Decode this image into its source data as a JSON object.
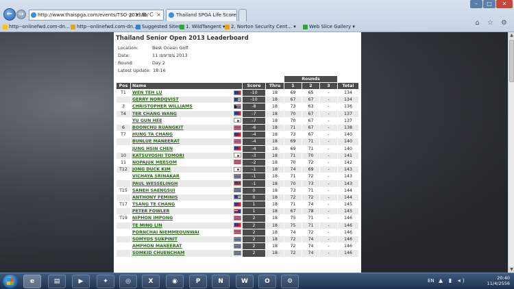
{
  "browser": {
    "address_url": "http://www.thaispga.com/events/TSO-2013/lb/",
    "address_tools": "ρ ▾ ⊠ C ×",
    "tab_title": "Thailand SPGA Life Scorebo...",
    "tab_close": "×",
    "new_tab": "",
    "back_glyph": "←",
    "forward_glyph": "→",
    "win_min": "–",
    "win_max": "□",
    "win_close": "✕",
    "right_icons": "⌂ ☆ ⚙",
    "favorites": [
      {
        "label": "http--onlinefwd.com-dn..."
      },
      {
        "label": "http--onlinefwd.com-dn..."
      },
      {
        "label": "Suggested Sites ▾"
      },
      {
        "label": "1. WildTangent ▾"
      },
      {
        "label": "2. Norton Security Cent... ▾"
      },
      {
        "label": "Web Slice Gallery ▾"
      }
    ]
  },
  "leaderboard": {
    "title": "Thailand Senior Open 2013 Leaderboard",
    "location_label": "Location:",
    "location": "Best Ocean Golf",
    "date_label": "Date:",
    "date": "11 เมษายน 2013",
    "round_label": "Round:",
    "round": "Day 2",
    "update_label": "Latest Update:",
    "update": "18:16",
    "headers": {
      "rounds": "Rounds",
      "pos": "Pos",
      "name": "Name",
      "score": "Score",
      "thru": "Thru",
      "r1": "1",
      "r2": "2",
      "r3": "3",
      "total": "Total"
    },
    "rows": [
      {
        "pos": "T1",
        "name": "WEN TEH LU",
        "flag": "tw",
        "score": "-10",
        "thru": "18",
        "r1": "69",
        "r2": "65",
        "r3": "-",
        "total": "134"
      },
      {
        "pos": "",
        "name": "GERRY NORDQVIST",
        "flag": "us",
        "score": "-10",
        "thru": "18",
        "r1": "67",
        "r2": "67",
        "r3": "-",
        "total": "134"
      },
      {
        "pos": "3",
        "name": "CHRISTOPHER WILLIAMS",
        "flag": "za",
        "score": "-8",
        "thru": "18",
        "r1": "73",
        "r2": "63",
        "r3": "-",
        "total": "136"
      },
      {
        "pos": "T4",
        "name": "TER CHANG WANG",
        "flag": "tw",
        "score": "-7",
        "thru": "18",
        "r1": "70",
        "r2": "67",
        "r3": "-",
        "total": "137"
      },
      {
        "pos": "",
        "name": "YU GUN HEE",
        "flag": "kr",
        "score": "-7",
        "thru": "18",
        "r1": "70",
        "r2": "67",
        "r3": "-",
        "total": "137"
      },
      {
        "pos": "6",
        "name": "BOONCHU RUANGKIT",
        "flag": "th",
        "score": "-6",
        "thru": "18",
        "r1": "71",
        "r2": "67",
        "r3": "-",
        "total": "138"
      },
      {
        "pos": "T7",
        "name": "HUNG TA CHANG",
        "flag": "tw",
        "score": "-4",
        "thru": "18",
        "r1": "73",
        "r2": "67",
        "r3": "-",
        "total": "140"
      },
      {
        "pos": "",
        "name": "BUNLUE MANEERAT",
        "flag": "th",
        "score": "-4",
        "thru": "18",
        "r1": "69",
        "r2": "71",
        "r3": "-",
        "total": "140"
      },
      {
        "pos": "",
        "name": "JUNG HSIN CHEN",
        "flag": "tw",
        "score": "-4",
        "thru": "18",
        "r1": "69",
        "r2": "71",
        "r3": "-",
        "total": "140"
      },
      {
        "pos": "10",
        "name": "KATSUYOSHI TOMORI",
        "flag": "jp",
        "score": "-3",
        "thru": "18",
        "r1": "71",
        "r2": "70",
        "r3": "-",
        "total": "141"
      },
      {
        "pos": "11",
        "name": "NOPAJUK MEESOM",
        "flag": "th",
        "score": "-2",
        "thru": "18",
        "r1": "70",
        "r2": "72",
        "r3": "-",
        "total": "142"
      },
      {
        "pos": "T12",
        "name": "JONG DUCK KIM",
        "flag": "kr",
        "score": "-1",
        "thru": "18",
        "r1": "74",
        "r2": "69",
        "r3": "-",
        "total": "143"
      },
      {
        "pos": "",
        "name": "VICHAYA SRINAKAR",
        "flag": "th",
        "score": "-1",
        "thru": "18",
        "r1": "71",
        "r2": "72",
        "r3": "-",
        "total": "143"
      },
      {
        "pos": "",
        "name": "PAUL WESSELINGH",
        "flag": "gb",
        "score": "-1",
        "thru": "18",
        "r1": "70",
        "r2": "73",
        "r3": "-",
        "total": "143"
      },
      {
        "pos": "T15",
        "name": "SANEH SAENGSUI",
        "flag": "th",
        "score": "0",
        "thru": "18",
        "r1": "73",
        "r2": "71",
        "r3": "-",
        "total": "144"
      },
      {
        "pos": "",
        "name": "ANTHONY FEMINIS",
        "flag": "us",
        "score": "0",
        "thru": "18",
        "r1": "72",
        "r2": "72",
        "r3": "-",
        "total": "144"
      },
      {
        "pos": "T17",
        "name": "TSANG TE CHANG",
        "flag": "tw",
        "score": "1",
        "thru": "18",
        "r1": "71",
        "r2": "74",
        "r3": "-",
        "total": "145"
      },
      {
        "pos": "",
        "name": "PETER FOWLER",
        "flag": "au",
        "score": "1",
        "thru": "18",
        "r1": "67",
        "r2": "78",
        "r3": "-",
        "total": "145"
      },
      {
        "pos": "T19",
        "name": "NIPHON IMPONG",
        "flag": "th",
        "score": "2",
        "thru": "18",
        "r1": "75",
        "r2": "71",
        "r3": "-",
        "total": "146"
      },
      {
        "pos": "",
        "name": "TE MING LIN",
        "flag": "tw",
        "score": "2",
        "thru": "18",
        "r1": "75",
        "r2": "71",
        "r3": "-",
        "total": "146"
      },
      {
        "pos": "",
        "name": "PORNCHAI NIEMMEOUNWAI",
        "flag": "th",
        "score": "2",
        "thru": "18",
        "r1": "74",
        "r2": "72",
        "r3": "-",
        "total": "146"
      },
      {
        "pos": "",
        "name": "SOMYOS SUKPINIT",
        "flag": "th",
        "score": "2",
        "thru": "18",
        "r1": "72",
        "r2": "74",
        "r3": "-",
        "total": "146"
      },
      {
        "pos": "",
        "name": "AMPHON MANEERAT",
        "flag": "th",
        "score": "2",
        "thru": "18",
        "r1": "72",
        "r2": "74",
        "r3": "-",
        "total": "146"
      },
      {
        "pos": "",
        "name": "SOMKID CHUENCHAM",
        "flag": "th",
        "score": "2",
        "thru": "18",
        "r1": "72",
        "r2": "74",
        "r3": "-",
        "total": "146"
      }
    ]
  },
  "taskbar": {
    "apps": [
      {
        "name": "internet-explorer",
        "glyph": "e"
      },
      {
        "name": "file-explorer",
        "glyph": "▤"
      },
      {
        "name": "media-player",
        "glyph": "▶"
      },
      {
        "name": "pin-app",
        "glyph": "✦"
      },
      {
        "name": "steering-wheel-app",
        "glyph": "◎"
      },
      {
        "name": "excel",
        "glyph": "X"
      },
      {
        "name": "chrome",
        "glyph": "◉"
      },
      {
        "name": "powerpoint",
        "glyph": "P"
      },
      {
        "name": "onenote",
        "glyph": "N"
      },
      {
        "name": "word",
        "glyph": "W"
      },
      {
        "name": "outlook",
        "glyph": "O"
      },
      {
        "name": "network-app",
        "glyph": "⚙"
      }
    ],
    "language": "EN",
    "tray_icons": "▲ ▮ ◂)",
    "time": "20:40",
    "date": "11/4/2556"
  },
  "colors": {
    "header_bg": "#4b4b4b",
    "name_link": "#2d6a1b",
    "alt_row": "#eaeaea"
  }
}
